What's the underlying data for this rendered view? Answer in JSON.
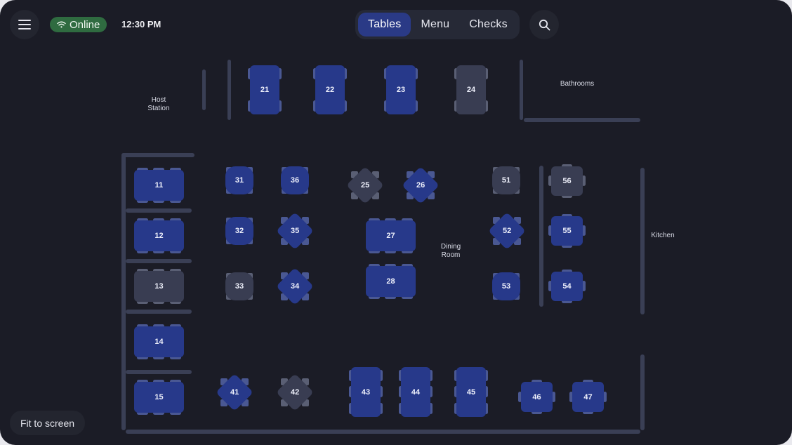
{
  "header": {
    "menu_icon": "hamburger-menu-icon",
    "status_label": "Online",
    "status_icon": "wifi-icon",
    "time": "12:30 PM",
    "tabs": [
      {
        "label": "Tables",
        "active": true
      },
      {
        "label": "Menu",
        "active": false
      },
      {
        "label": "Checks",
        "active": false
      }
    ],
    "search_icon": "search-icon"
  },
  "footer": {
    "fit_label": "Fit to screen"
  },
  "areas": {
    "host": "Host\nStation",
    "bathrooms": "Bathrooms",
    "dining": "Dining\nRoom",
    "kitchen": "Kitchen"
  },
  "tables": {
    "t21": "21",
    "t22": "22",
    "t23": "23",
    "t24": "24",
    "t11": "11",
    "t12": "12",
    "t13": "13",
    "t14": "14",
    "t15": "15",
    "t31": "31",
    "t32": "32",
    "t33": "33",
    "t36": "36",
    "t35": "35",
    "t34": "34",
    "t25": "25",
    "t26": "26",
    "t27": "27",
    "t28": "28",
    "t51": "51",
    "t52": "52",
    "t53": "53",
    "t56": "56",
    "t55": "55",
    "t54": "54",
    "t41": "41",
    "t42": "42",
    "t43": "43",
    "t44": "44",
    "t45": "45",
    "t46": "46",
    "t47": "47"
  },
  "colors": {
    "background": "#1b1c26",
    "table_occupied": "#27398a",
    "table_available": "#393d52",
    "online": "#2f6b40",
    "wall": "#3a3f55"
  }
}
